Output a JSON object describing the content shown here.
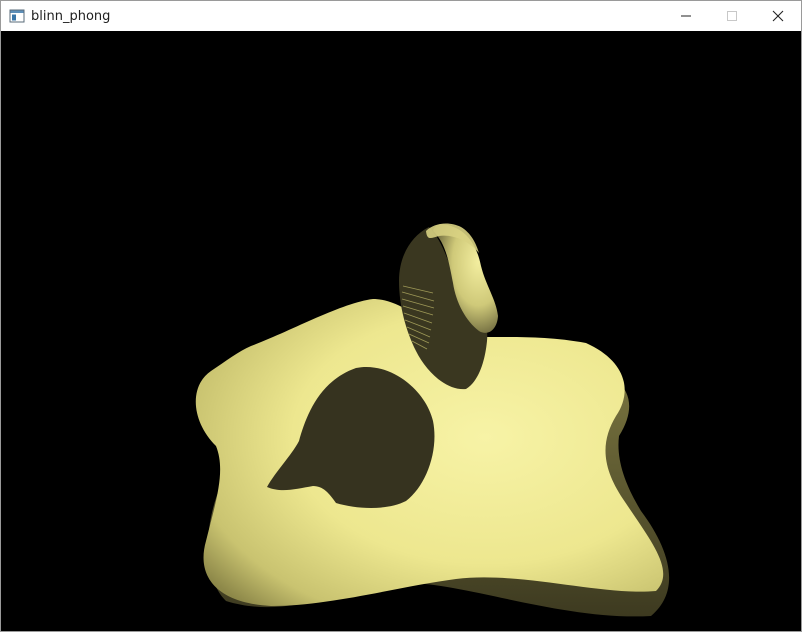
{
  "window": {
    "title": "blinn_phong",
    "icon": "app-window-icon",
    "controls": [
      "minimize-icon",
      "maximize-icon",
      "close-icon"
    ]
  },
  "viewport": {
    "background": "#000000",
    "scene": {
      "objects": [
        "star-shaped-blob-mesh",
        "rounded-blob-mesh"
      ],
      "material_color": "#f1ec98",
      "shadow_color": "#36331f"
    }
  }
}
